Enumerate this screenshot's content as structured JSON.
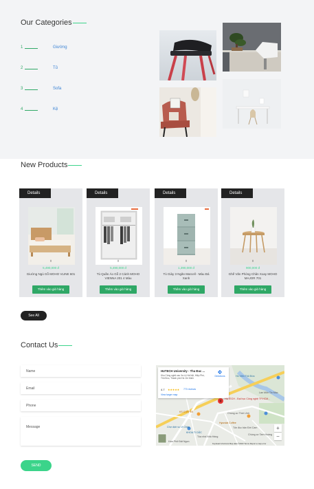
{
  "categories": {
    "title": "Our Categories",
    "items": [
      {
        "num": "1",
        "name": "Giường"
      },
      {
        "num": "2",
        "name": "Tủ"
      },
      {
        "num": "3",
        "name": "Sofa"
      },
      {
        "num": "4",
        "name": "Kệ"
      }
    ]
  },
  "new_products": {
    "title": "New Products",
    "badge_label": "Details",
    "dots": "⠿",
    "button_label": "Thêm vào giỏ hàng",
    "items": [
      {
        "price": "5,490,000 đ",
        "name": "Giường Ngủ Gỗ MOHO VLINE 601"
      },
      {
        "price": "5,490,000 đ",
        "name": "Tủ Quần Áo Gỗ 2 Cánh MOHO VIENNA 201 4 Màu"
      },
      {
        "price": "1,390,000 đ",
        "name": "Tủ Giày 3 Ngăn Marcell - Màu Đá Xanh"
      },
      {
        "price": "900,000 đ",
        "name": "Ghế Văn Phòng Chân Xoay MOHO MAJOR 701"
      }
    ],
    "see_all_label": "See All"
  },
  "contact": {
    "title": "Contact Us",
    "name_placeholder": "Name",
    "email_placeholder": "Email",
    "phone_placeholder": "Phone",
    "message_placeholder": "Message",
    "send_label": "SEND"
  },
  "map": {
    "place_title": "HUTECH University - Thu Đuc ...",
    "address": "Khu Công nghệ cao Xa Lộ Hà Nội, Hiệp Phú, Thủ Đức, Thành phố Hồ Chí Minh",
    "rating": "4.7",
    "stars": "★★★★★",
    "reviews": "770 reviews",
    "larger_map": "View larger map",
    "directions": "Directions",
    "pin_label": "HUTECH - Đại học Công nghệ TP.HCM...",
    "labels": {
      "b1": "Hồ Viên Thủ Đức",
      "b2": "KS COFFEE",
      "b3": "Chùng cư Thới Lĩnh",
      "b4": "Tôn đuc bản Đời Cam",
      "b5": "Chợ dịch vụ Vi Châu",
      "b6": "KHOA TI DŨC",
      "b7": "Tòa nhà Nhà Hàng",
      "b8": "Chùng cư Tam Hoàng",
      "b9": "Hoa Phở Đất Ngon",
      "b10": "Hyundai Coffee",
      "b11": "Lan Môn Tin Mác"
    },
    "footer": "Keyboard shortcuts   Map data ©2023   Terms   Report a map error"
  },
  "colors": {
    "accent": "#3bd48a",
    "green_button": "#2fa866",
    "dark": "#222222",
    "link": "#3a82d4"
  }
}
